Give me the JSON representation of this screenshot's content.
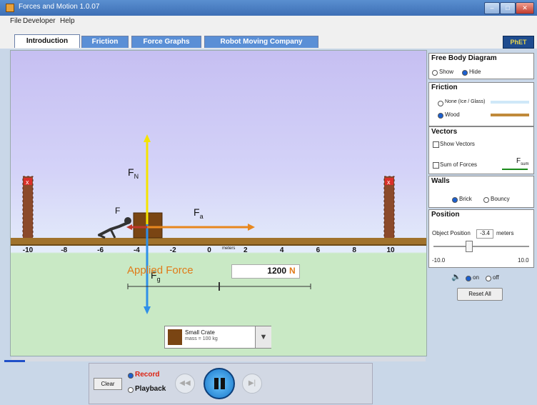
{
  "window": {
    "title": "Forces and Motion 1.0.07"
  },
  "menu": [
    "File",
    "Developer",
    "Help"
  ],
  "tabs": [
    {
      "label": "Introduction",
      "active": true
    },
    {
      "label": "Friction",
      "active": false
    },
    {
      "label": "Force Graphs",
      "active": false
    },
    {
      "label": "Robot Moving Company",
      "active": false
    }
  ],
  "logo": "PhET",
  "scene": {
    "axis_ticks": [
      "-10",
      "-8",
      "-6",
      "-4",
      "-2",
      "0",
      "2",
      "4",
      "6",
      "8",
      "10"
    ],
    "axis_unit": "meters",
    "vectors": {
      "normal": "F",
      "normal_sub": "N",
      "applied": "F",
      "applied_sub": "a",
      "friction": "F",
      "gravity": "F",
      "gravity_sub": "g"
    },
    "applied_force_label": "Applied Force",
    "applied_force_value": "1200",
    "applied_force_unit": "N",
    "object_name": "Small Crate",
    "object_detail": "mass = 100 kg"
  },
  "playback": {
    "clear": "Clear",
    "record": "Record",
    "playback": "Playback",
    "timeline_progress": 0.05
  },
  "panel": {
    "fbd": {
      "title": "Free Body Diagram",
      "options": [
        "Show",
        "Hide"
      ],
      "selected": "Hide"
    },
    "friction": {
      "title": "Friction",
      "options": [
        "None (Ice / Glass)",
        "Wood"
      ],
      "selected": "Wood"
    },
    "vectors": {
      "title": "Vectors",
      "items": [
        "Show Vectors",
        "Sum of Forces"
      ],
      "sum_symbol": "F",
      "sum_sub": "sum"
    },
    "walls": {
      "title": "Walls",
      "options": [
        "Brick",
        "Bouncy"
      ],
      "selected": "Brick"
    },
    "position": {
      "title": "Position",
      "label": "Object Position",
      "value": "-3.4",
      "unit": "meters",
      "min": "-10.0",
      "max": "10.0"
    },
    "sound": {
      "options": [
        "on",
        "off"
      ],
      "selected": "on"
    },
    "reset": "Reset All"
  },
  "colors": {
    "normal": "#f5e400",
    "applied": "#e8871e",
    "gravity": "#2f8fe8",
    "friction": "#c0392b",
    "tab": "#5a8fd6"
  }
}
